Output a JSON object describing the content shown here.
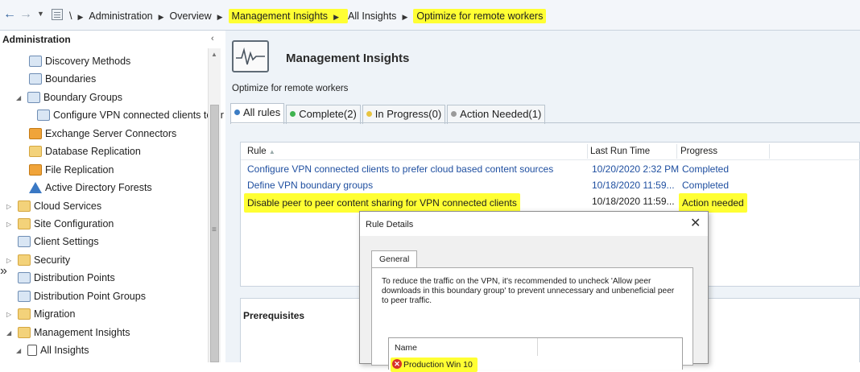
{
  "breadcrumb": {
    "root": "\\",
    "items": [
      "Administration",
      "Overview",
      "Management Insights",
      "All Insights",
      "Optimize for remote workers"
    ]
  },
  "tree": {
    "title": "Administration",
    "items": [
      {
        "label": "Discovery Methods",
        "icon": "discovery-methods-icon"
      },
      {
        "label": "Boundaries",
        "icon": "boundaries-icon"
      },
      {
        "label": "Boundary Groups",
        "icon": "boundary-groups-icon"
      },
      {
        "label": "Configure VPN connected clients to pr",
        "icon": "boundary-group-icon"
      },
      {
        "label": "Exchange Server Connectors",
        "icon": "exchange-connector-icon"
      },
      {
        "label": "Database Replication",
        "icon": "database-replication-icon"
      },
      {
        "label": "File Replication",
        "icon": "file-replication-icon"
      },
      {
        "label": "Active Directory Forests",
        "icon": "active-directory-icon"
      },
      {
        "label": "Cloud Services",
        "icon": "folder-icon"
      },
      {
        "label": "Site Configuration",
        "icon": "folder-icon"
      },
      {
        "label": "Client Settings",
        "icon": "client-settings-icon"
      },
      {
        "label": "Security",
        "icon": "folder-icon"
      },
      {
        "label": "Distribution Points",
        "icon": "distribution-points-icon"
      },
      {
        "label": "Distribution Point Groups",
        "icon": "distribution-point-groups-icon"
      },
      {
        "label": "Migration",
        "icon": "folder-icon"
      },
      {
        "label": "Management Insights",
        "icon": "folder-icon"
      },
      {
        "label": "All Insights",
        "icon": "all-insights-icon"
      }
    ]
  },
  "main": {
    "title": "Management Insights",
    "subtitle": "Optimize for remote workers",
    "tabs": [
      {
        "label": "All rules",
        "color": "#3c7dc4"
      },
      {
        "label": "Complete(2)",
        "color": "#3fb34f"
      },
      {
        "label": "In Progress(0)",
        "color": "#e8c441"
      },
      {
        "label": "Action Needed(1)",
        "color": "#9a9a9a"
      }
    ],
    "table": {
      "columns": [
        "Rule",
        "Last Run Time",
        "Progress"
      ],
      "sort_indicator": "▲",
      "rows": [
        {
          "rule": "Configure VPN connected clients to prefer cloud based content sources",
          "last_run": "10/20/2020 2:32 PM",
          "progress": "Completed"
        },
        {
          "rule": "Define VPN boundary groups",
          "last_run": "10/18/2020 11:59...",
          "progress": "Completed"
        },
        {
          "rule": "Disable peer to peer content sharing for VPN connected clients",
          "last_run": "10/18/2020 11:59...",
          "progress": "Action needed"
        }
      ]
    },
    "prerequisites_title": "Prerequisites"
  },
  "dialog": {
    "title": "Rule Details",
    "tab": "General",
    "description": "To reduce the traffic on the VPN, it's recommended to uncheck 'Allow peer downloads in this boundary group' to prevent unnecessary and unbeneficial peer to peer traffic.",
    "list_column": "Name",
    "list_item": "Production Win 10"
  },
  "highlight_color": "#ffff33"
}
